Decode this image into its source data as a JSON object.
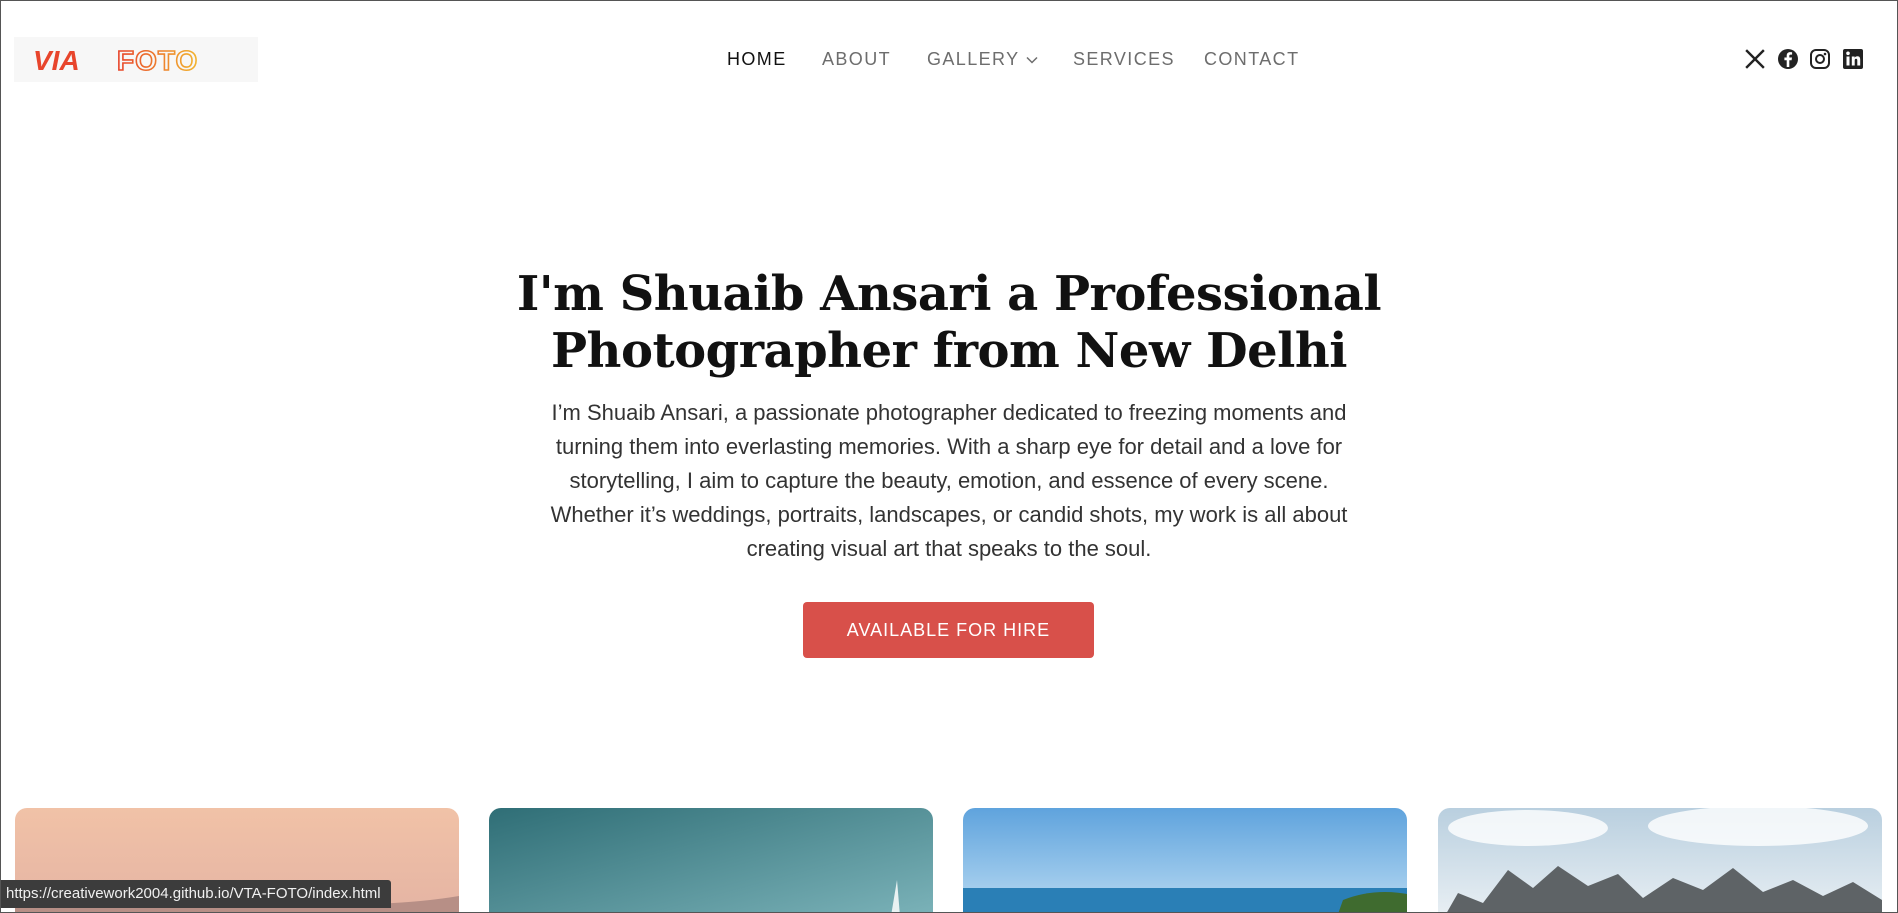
{
  "header": {
    "logo": {
      "part1": "VIA",
      "part2": "FOTO"
    },
    "nav": [
      {
        "label": "HOME",
        "active": true
      },
      {
        "label": "ABOUT",
        "active": false
      },
      {
        "label": "GALLERY",
        "active": false,
        "has_dropdown": true
      },
      {
        "label": "SERVICES",
        "active": false
      },
      {
        "label": "CONTACT",
        "active": false
      }
    ],
    "social": [
      "x-icon",
      "facebook-icon",
      "instagram-icon",
      "linkedin-icon"
    ]
  },
  "hero": {
    "title_prefix": "I'm ",
    "title_highlight": "Shuaib Ansari",
    "title_suffix_line1": " a Professional",
    "title_line2": "Photographer from New Delhi",
    "description": "I’m Shuaib Ansari, a passionate photographer dedicated to freezing moments and turning them into everlasting memories. With a sharp eye for detail and a love for storytelling, I aim to capture the beauty, emotion, and essence of every scene. Whether it’s weddings, portraits, landscapes, or candid shots, my work is all about creating visual art that speaks to the soul.",
    "cta_label": "AVAILABLE FOR HIRE"
  },
  "gallery": {
    "images": [
      "sunset-photo",
      "teal-sky-photo",
      "sea-photo",
      "mountain-photo"
    ]
  },
  "status_bar": {
    "url": "https://creativework2004.github.io/VTA-FOTO/index.html"
  },
  "colors": {
    "accent": "#d8504a",
    "logo_red": "#e8452c",
    "logo_orange": "#f0a030",
    "nav_text": "#6d6d6d",
    "nav_active": "#111111"
  }
}
